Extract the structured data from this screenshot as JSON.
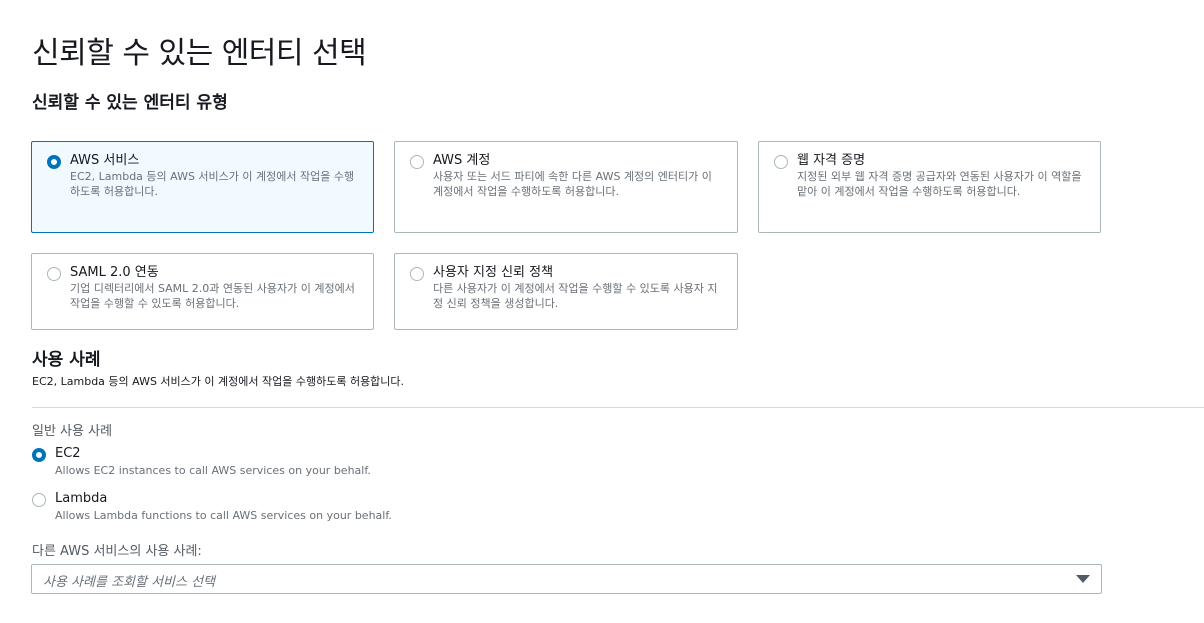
{
  "page": {
    "title": "신뢰할 수 있는 엔터티 선택"
  },
  "entity_type": {
    "heading": "신뢰할 수 있는 엔터티 유형",
    "selected": "aws-service",
    "tiles": [
      {
        "id": "aws-service",
        "label": "AWS 서비스",
        "description": "EC2, Lambda 등의 AWS 서비스가 이 계정에서 작업을 수행하도록 허용합니다.",
        "checked": true
      },
      {
        "id": "aws-account",
        "label": "AWS 계정",
        "description": "사용자 또는 서드 파티에 속한 다른 AWS 계정의 엔터티가 이 계정에서 작업을 수행하도록 허용합니다.",
        "checked": false
      },
      {
        "id": "web-identity",
        "label": "웹 자격 증명",
        "description": "지정된 외부 웹 자격 증명 공급자와 연동된 사용자가 이 역할을 맡아 이 계정에서 작업을 수행하도록 허용합니다.",
        "checked": false
      },
      {
        "id": "saml",
        "label": "SAML 2.0 연동",
        "description": "기업 디렉터리에서 SAML 2.0과 연동된 사용자가 이 계정에서 작업을 수행할 수 있도록 허용합니다.",
        "checked": false
      },
      {
        "id": "custom-trust-policy",
        "label": "사용자 지정 신뢰 정책",
        "description": "다른 사용자가 이 계정에서 작업을 수행할 수 있도록 사용자 지정 신뢰 정책을 생성합니다.",
        "checked": false
      }
    ]
  },
  "use_case": {
    "heading": "사용 사례",
    "description": "EC2, Lambda 등의 AWS 서비스가 이 계정에서 작업을 수행하도록 허용합니다.",
    "common_label": "일반 사용 사례",
    "options": [
      {
        "id": "ec2",
        "label": "EC2",
        "description": "Allows EC2 instances to call AWS services on your behalf.",
        "checked": true
      },
      {
        "id": "lambda",
        "label": "Lambda",
        "description": "Allows Lambda functions to call AWS services on your behalf.",
        "checked": false
      }
    ],
    "other_label": "다른 AWS 서비스의 사용 사례:",
    "select_placeholder": "사용 사례를 조회할 서비스 선택"
  },
  "colors": {
    "accent": "#0073bb",
    "selected_tile_bg": "#f1faff",
    "border": "#aab7b8",
    "muted_text": "#687078"
  }
}
